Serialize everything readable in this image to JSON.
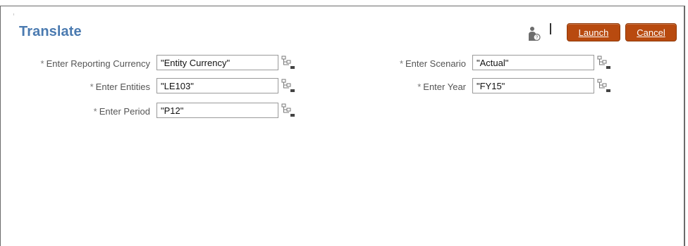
{
  "header": {
    "title": "Translate",
    "launch_label": "Launch",
    "cancel_label": "Cancel"
  },
  "colors": {
    "title": "#4a7ab0",
    "button_bg": "#b84a0f",
    "label": "#555555"
  },
  "icons": {
    "help": "user-help-icon",
    "member_selector": "member-selector-icon"
  },
  "form": {
    "required_mark": "*",
    "reporting_currency": {
      "label": "Enter Reporting Currency",
      "value": "\"Entity Currency\""
    },
    "entities": {
      "label": "Enter Entities",
      "value": "\"LE103\""
    },
    "period": {
      "label": "Enter Period",
      "value": "\"P12\""
    },
    "scenario": {
      "label": "Enter Scenario",
      "value": "\"Actual\""
    },
    "year": {
      "label": "Enter Year",
      "value": "\"FY15\""
    }
  }
}
